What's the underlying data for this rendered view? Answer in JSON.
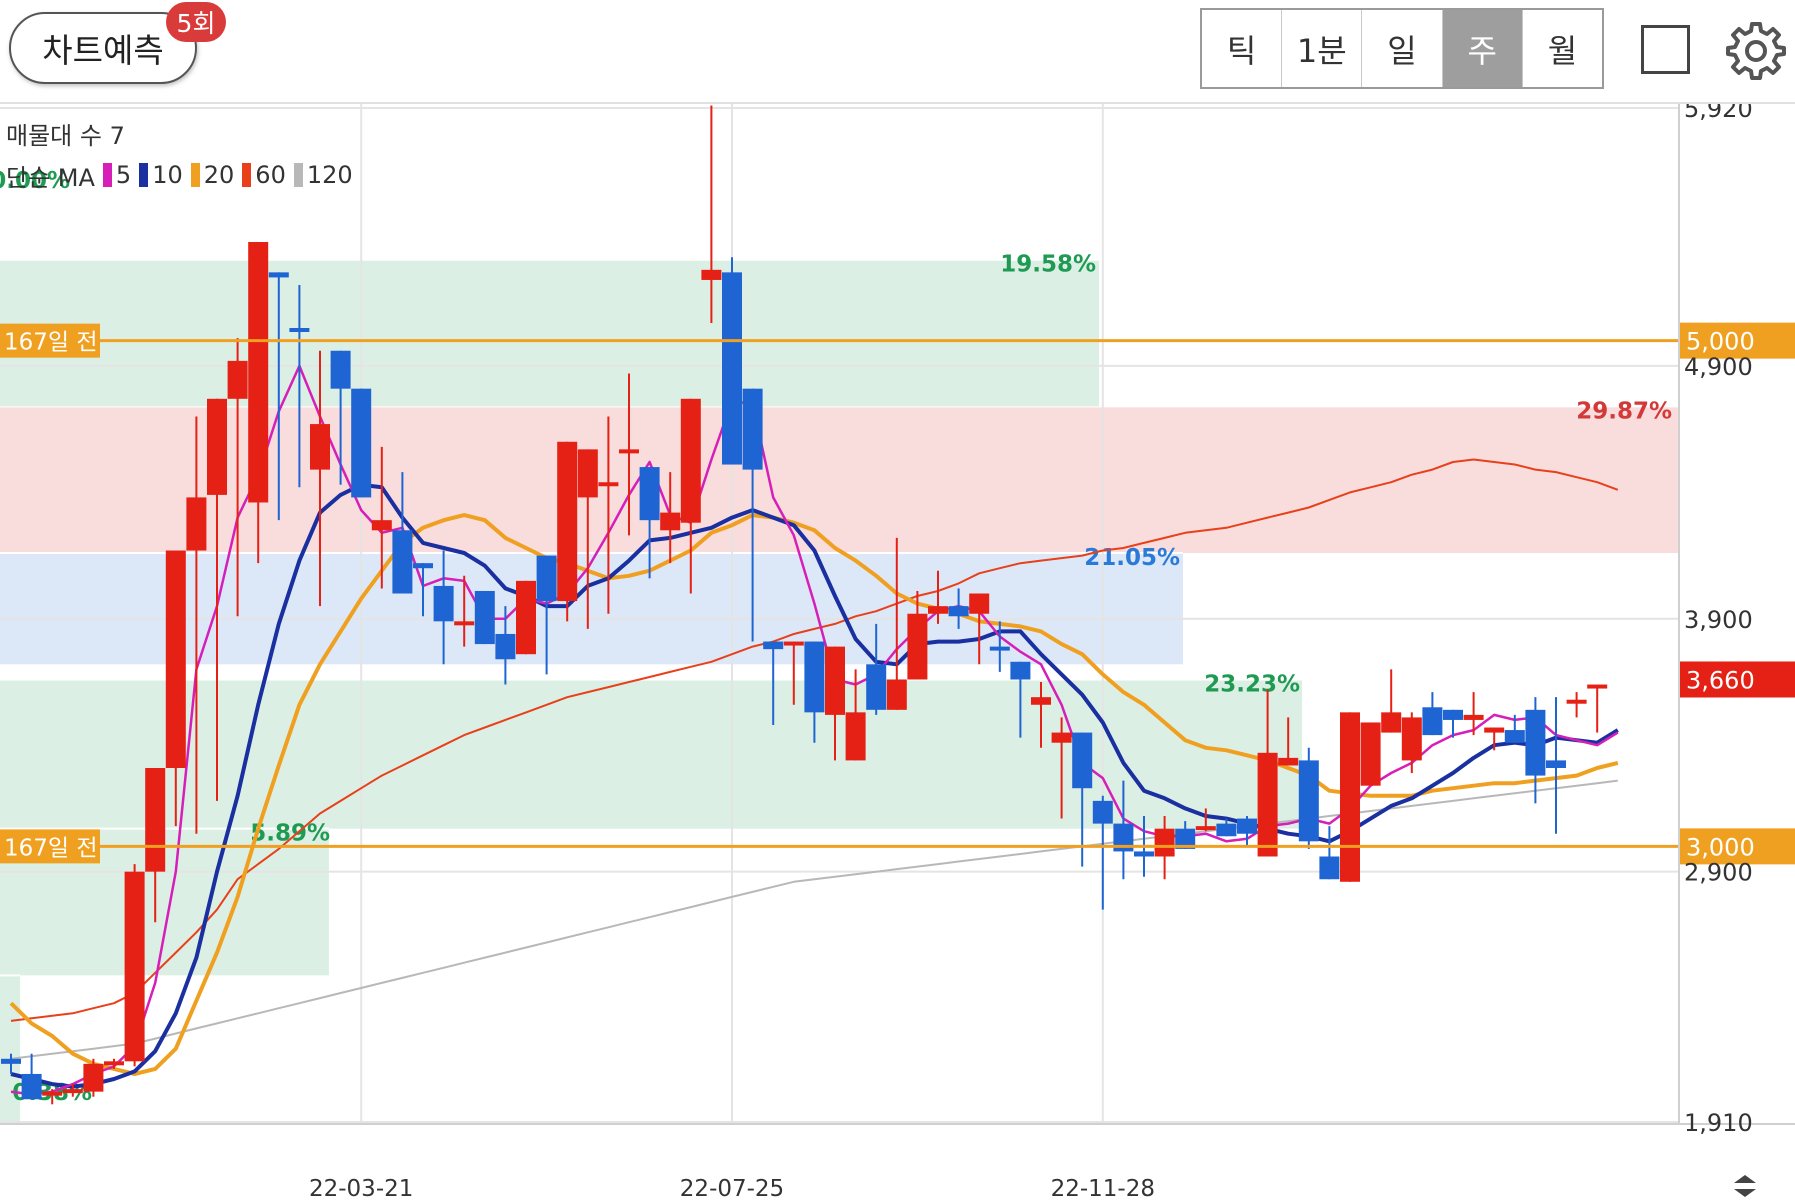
{
  "header": {
    "predict_label": "차트예측",
    "predict_count": "5회",
    "period_tabs": [
      {
        "label": "틱",
        "active": false
      },
      {
        "label": "1분",
        "active": false
      },
      {
        "label": "일",
        "active": false
      },
      {
        "label": "주",
        "active": true
      },
      {
        "label": "월",
        "active": false
      }
    ],
    "fullscreen_icon": "square-outline-icon",
    "settings_icon": "gear-icon"
  },
  "legend": {
    "volume_profile_label": "매물대 수 7",
    "ma_label": "단순 MA",
    "ma_items": [
      {
        "period": "5",
        "color": "#d61fb8"
      },
      {
        "period": "10",
        "color": "#1a2fa0"
      },
      {
        "period": "20",
        "color": "#f0a020"
      },
      {
        "period": "60",
        "color": "#e8401a"
      },
      {
        "period": "120",
        "color": "#b8b8b8"
      }
    ]
  },
  "colors": {
    "up": "#e52014",
    "down": "#1e64d2",
    "ref_line": "#f0a020",
    "current_price_bg": "#e52014"
  },
  "chart_data": {
    "type": "candlestick",
    "period": "weekly",
    "y_range": [
      1910,
      5920
    ],
    "x_tick_labels": [
      "22-03-21",
      "22-07-25",
      "22-11-28"
    ],
    "y_tick_labels": [
      "5,920",
      "4,900",
      "3,900",
      "2,900",
      "1,910"
    ],
    "current_price": "3,660",
    "reference_lines": [
      {
        "value": 5000,
        "label": "167일 전",
        "value_label": "5,000"
      },
      {
        "value": 3000,
        "label": "167일 전",
        "value_label": "3,000"
      }
    ],
    "zones": [
      {
        "from": 4160,
        "to": 4740,
        "label": "29.87%",
        "fill": "#f9dcdc",
        "text_color": "#d23a3a"
      },
      {
        "from": 3720,
        "to": 4160,
        "label": "21.05%",
        "fill": "#dce8f7",
        "text_color": "#2a7ad8"
      },
      {
        "from": 4740,
        "to": 5320,
        "label": "19.58%",
        "fill": "#dcefe4",
        "text_color": "#1e9a52"
      },
      {
        "from": 3070,
        "to": 3660,
        "label": "23.23%",
        "fill": "#dcefe4",
        "text_color": "#1e9a52"
      },
      {
        "from": 2490,
        "to": 3070,
        "label": "5.89%",
        "fill": "#dcefe4",
        "text_color": "#1e9a52"
      },
      {
        "from": 1910,
        "to": 2490,
        "label": "0.38%",
        "fill": "#dcefe4",
        "text_color": "#1e9a52"
      },
      {
        "from": 5920,
        "to": 5920,
        "label": "0.00%",
        "fill": "#dcefe4",
        "text_color": "#1e9a52"
      }
    ],
    "candles": [
      [
        2160,
        2180,
        2100,
        2140
      ],
      [
        2100,
        2180,
        2010,
        2000
      ],
      [
        2030,
        2040,
        1980,
        2030
      ],
      [
        2040,
        2060,
        2010,
        2040
      ],
      [
        2030,
        2160,
        2010,
        2140
      ],
      [
        2140,
        2160,
        2120,
        2150
      ],
      [
        2150,
        2930,
        2130,
        2900
      ],
      [
        2900,
        3310,
        2700,
        3310
      ],
      [
        3310,
        4170,
        3080,
        4170
      ],
      [
        4170,
        4700,
        3050,
        4380
      ],
      [
        4390,
        4700,
        3180,
        4770
      ],
      [
        4770,
        5010,
        3910,
        4920
      ],
      [
        4360,
        5340,
        4120,
        5390
      ],
      [
        5270,
        5250,
        4290,
        5250
      ],
      [
        5050,
        5220,
        4420,
        5040
      ],
      [
        4490,
        4960,
        3950,
        4670
      ],
      [
        4960,
        4940,
        4430,
        4810
      ],
      [
        4810,
        4760,
        4390,
        4380
      ],
      [
        4250,
        4580,
        4020,
        4290
      ],
      [
        4250,
        4160,
        4480,
        4000
      ],
      [
        4120,
        4120,
        3910,
        4100
      ],
      [
        4030,
        4170,
        3720,
        3890
      ],
      [
        3880,
        4070,
        3790,
        3890
      ],
      [
        4010,
        4010,
        3910,
        3800
      ],
      [
        3840,
        3950,
        3640,
        3740
      ],
      [
        3760,
        4000,
        3780,
        4050
      ],
      [
        4150,
        3840,
        3680,
        3970
      ],
      [
        3970,
        4400,
        3890,
        4600
      ],
      [
        4380,
        4510,
        3860,
        4570
      ],
      [
        4440,
        4700,
        3920,
        4440
      ],
      [
        4570,
        4870,
        4230,
        4570
      ],
      [
        4500,
        4390,
        4060,
        4290
      ],
      [
        4250,
        4480,
        4120,
        4320
      ],
      [
        4280,
        4770,
        4000,
        4770
      ],
      [
        5240,
        5930,
        5070,
        5280
      ],
      [
        5270,
        5330,
        4950,
        4510
      ],
      [
        4810,
        4700,
        3810,
        4490
      ],
      [
        3810,
        3670,
        3480,
        3780
      ],
      [
        3800,
        3760,
        3560,
        3810
      ],
      [
        3810,
        3760,
        3410,
        3530
      ],
      [
        3520,
        3780,
        3340,
        3790
      ],
      [
        3340,
        3700,
        3360,
        3530
      ],
      [
        3720,
        3880,
        3520,
        3540
      ],
      [
        3540,
        4220,
        3760,
        3660
      ],
      [
        3660,
        4010,
        3680,
        3920
      ],
      [
        3920,
        4090,
        3880,
        3950
      ],
      [
        3950,
        4020,
        3860,
        3910
      ],
      [
        3920,
        3960,
        3720,
        4000
      ],
      [
        3790,
        3890,
        3690,
        3780
      ],
      [
        3730,
        3620,
        3430,
        3660
      ],
      [
        3560,
        3650,
        3390,
        3590
      ],
      [
        3410,
        3510,
        3110,
        3450
      ],
      [
        3450,
        3230,
        2920,
        3230
      ],
      [
        3180,
        3200,
        2750,
        3090
      ],
      [
        3090,
        3260,
        2870,
        2980
      ],
      [
        2980,
        3120,
        2880,
        2960
      ],
      [
        2960,
        3120,
        2870,
        3070
      ],
      [
        3070,
        3100,
        3020,
        2990
      ],
      [
        3080,
        3150,
        3060,
        3080
      ],
      [
        3090,
        3110,
        3050,
        3040
      ],
      [
        3110,
        3120,
        3000,
        3050
      ],
      [
        2960,
        3620,
        3060,
        3370
      ],
      [
        3320,
        3510,
        3460,
        3350
      ],
      [
        3340,
        3390,
        2990,
        3020
      ],
      [
        2960,
        3080,
        3020,
        2870
      ],
      [
        2860,
        3370,
        3320,
        3530
      ],
      [
        3240,
        3480,
        3250,
        3490
      ],
      [
        3450,
        3700,
        3480,
        3530
      ],
      [
        3340,
        3530,
        3290,
        3510
      ],
      [
        3550,
        3610,
        3440,
        3440
      ],
      [
        3540,
        3500,
        3430,
        3500
      ],
      [
        3500,
        3610,
        3440,
        3520
      ],
      [
        3450,
        3420,
        3380,
        3470
      ],
      [
        3460,
        3520,
        3410,
        3410
      ],
      [
        3540,
        3590,
        3170,
        3280
      ],
      [
        3340,
        3590,
        3050,
        3310
      ],
      [
        3580,
        3610,
        3510,
        3580
      ],
      [
        3630,
        3550,
        3450,
        3640
      ]
    ],
    "moving_averages": {
      "5": [
        2030,
        2020,
        2030,
        2060,
        2100,
        2130,
        2210,
        2460,
        2900,
        3700,
        3950,
        4300,
        4470,
        4720,
        4900,
        4700,
        4510,
        4330,
        4240,
        4260,
        4030,
        4060,
        4050,
        3900,
        3900,
        3980,
        3960,
        4000,
        4100,
        4240,
        4390,
        4520,
        4310,
        4280,
        4530,
        4760,
        4750,
        4380,
        4230,
        3960,
        3660,
        3640,
        3680,
        3780,
        3860,
        3930,
        3950,
        3930,
        3830,
        3770,
        3720,
        3560,
        3330,
        3270,
        3110,
        3060,
        3040,
        3040,
        3050,
        3020,
        3030,
        3080,
        3090,
        3110,
        3090,
        3150,
        3240,
        3290,
        3330,
        3400,
        3440,
        3460,
        3520,
        3500,
        3510,
        3440,
        3420,
        3400,
        3450
      ],
      "10": [
        2100,
        2080,
        2060,
        2050,
        2060,
        2080,
        2110,
        2190,
        2340,
        2560,
        2900,
        3200,
        3560,
        3880,
        4130,
        4320,
        4390,
        4430,
        4420,
        4300,
        4200,
        4180,
        4160,
        4110,
        4020,
        3990,
        3950,
        3950,
        4030,
        4060,
        4130,
        4210,
        4220,
        4240,
        4260,
        4300,
        4330,
        4300,
        4270,
        4170,
        3990,
        3820,
        3730,
        3720,
        3800,
        3810,
        3810,
        3820,
        3850,
        3850,
        3760,
        3680,
        3600,
        3490,
        3330,
        3220,
        3190,
        3150,
        3120,
        3110,
        3090,
        3070,
        3050,
        3040,
        3020,
        3060,
        3110,
        3160,
        3190,
        3240,
        3290,
        3350,
        3400,
        3410,
        3400,
        3430,
        3420,
        3410,
        3460
      ],
      "20": [
        2380,
        2300,
        2250,
        2180,
        2140,
        2120,
        2100,
        2120,
        2200,
        2390,
        2580,
        2800,
        3070,
        3320,
        3560,
        3720,
        3850,
        3980,
        4090,
        4200,
        4260,
        4290,
        4310,
        4290,
        4220,
        4180,
        4140,
        4120,
        4090,
        4060,
        4070,
        4090,
        4130,
        4170,
        4240,
        4270,
        4310,
        4300,
        4280,
        4250,
        4180,
        4130,
        4070,
        4000,
        3960,
        3940,
        3920,
        3890,
        3880,
        3870,
        3850,
        3800,
        3760,
        3680,
        3610,
        3560,
        3490,
        3420,
        3390,
        3380,
        3360,
        3340,
        3310,
        3280,
        3220,
        3210,
        3200,
        3200,
        3200,
        3220,
        3230,
        3240,
        3250,
        3250,
        3260,
        3270,
        3280,
        3310,
        3330
      ],
      "60": [
        2310,
        2320,
        2330,
        2340,
        2360,
        2380,
        2420,
        2500,
        2580,
        2660,
        2750,
        2870,
        2930,
        2990,
        3060,
        3130,
        3180,
        3230,
        3280,
        3320,
        3360,
        3400,
        3440,
        3470,
        3500,
        3530,
        3560,
        3590,
        3610,
        3630,
        3650,
        3670,
        3690,
        3710,
        3730,
        3760,
        3790,
        3810,
        3840,
        3860,
        3880,
        3910,
        3930,
        3960,
        3990,
        4010,
        4040,
        4080,
        4100,
        4120,
        4130,
        4140,
        4150,
        4170,
        4180,
        4200,
        4220,
        4240,
        4250,
        4260,
        4280,
        4300,
        4320,
        4340,
        4370,
        4400,
        4420,
        4440,
        4470,
        4490,
        4520,
        4530,
        4520,
        4510,
        4490,
        4480,
        4460,
        4440,
        4410
      ],
      "120": [
        2160,
        2170,
        2180,
        2190,
        2200,
        2210,
        2220,
        2240,
        2260,
        2280,
        2300,
        2320,
        2340,
        2360,
        2380,
        2400,
        2420,
        2440,
        2460,
        2480,
        2500,
        2520,
        2540,
        2560,
        2580,
        2600,
        2620,
        2640,
        2660,
        2680,
        2700,
        2720,
        2740,
        2760,
        2780,
        2800,
        2820,
        2840,
        2860,
        2870,
        2880,
        2890,
        2900,
        2910,
        2920,
        2930,
        2940,
        2950,
        2960,
        2970,
        2980,
        2990,
        3000,
        3010,
        3020,
        3030,
        3040,
        3050,
        3060,
        3070,
        3080,
        3090,
        3100,
        3110,
        3120,
        3130,
        3140,
        3150,
        3160,
        3170,
        3180,
        3190,
        3200,
        3210,
        3220,
        3230,
        3240,
        3250,
        3260
      ]
    }
  }
}
